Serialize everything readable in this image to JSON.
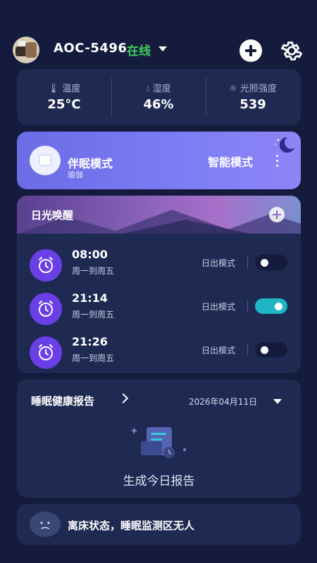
{
  "header": {
    "device_name": "AOC-5496",
    "status": "在线",
    "add_icon": "plus-circle-icon",
    "settings_icon": "gear-icon"
  },
  "environment": [
    {
      "icon": "thermometer-icon",
      "label": "温度",
      "value": "25°C"
    },
    {
      "icon": "water-drop-icon",
      "label": "湿度",
      "value": "46%"
    },
    {
      "icon": "sun-icon",
      "label": "光照强度",
      "value": "539"
    }
  ],
  "mode": {
    "title": "伴眠模式",
    "subtitle": "瑜伽",
    "right_label": "智能模式",
    "menu_icon": "more-vertical-icon"
  },
  "sunlight": {
    "title": "日光唤醒",
    "alarms": [
      {
        "time": "08:00",
        "days": "周一到周五",
        "mode": "日出模式",
        "enabled": false
      },
      {
        "time": "21:14",
        "days": "周一到周五",
        "mode": "日出模式",
        "enabled": true
      },
      {
        "time": "21:26",
        "days": "周一到周五",
        "mode": "日出模式",
        "enabled": false
      }
    ]
  },
  "report": {
    "title": "睡眠健康报告",
    "date": "2026年04月11日",
    "generate": "生成今日报告"
  },
  "bed_status": {
    "text": "离床状态，睡眠监测区无人"
  },
  "colors": {
    "background": "#141b3d",
    "card": "#1f2a52",
    "online": "#3ccf5c",
    "accent": "#6a3fe6",
    "switch_on": "#1eb5c4"
  }
}
